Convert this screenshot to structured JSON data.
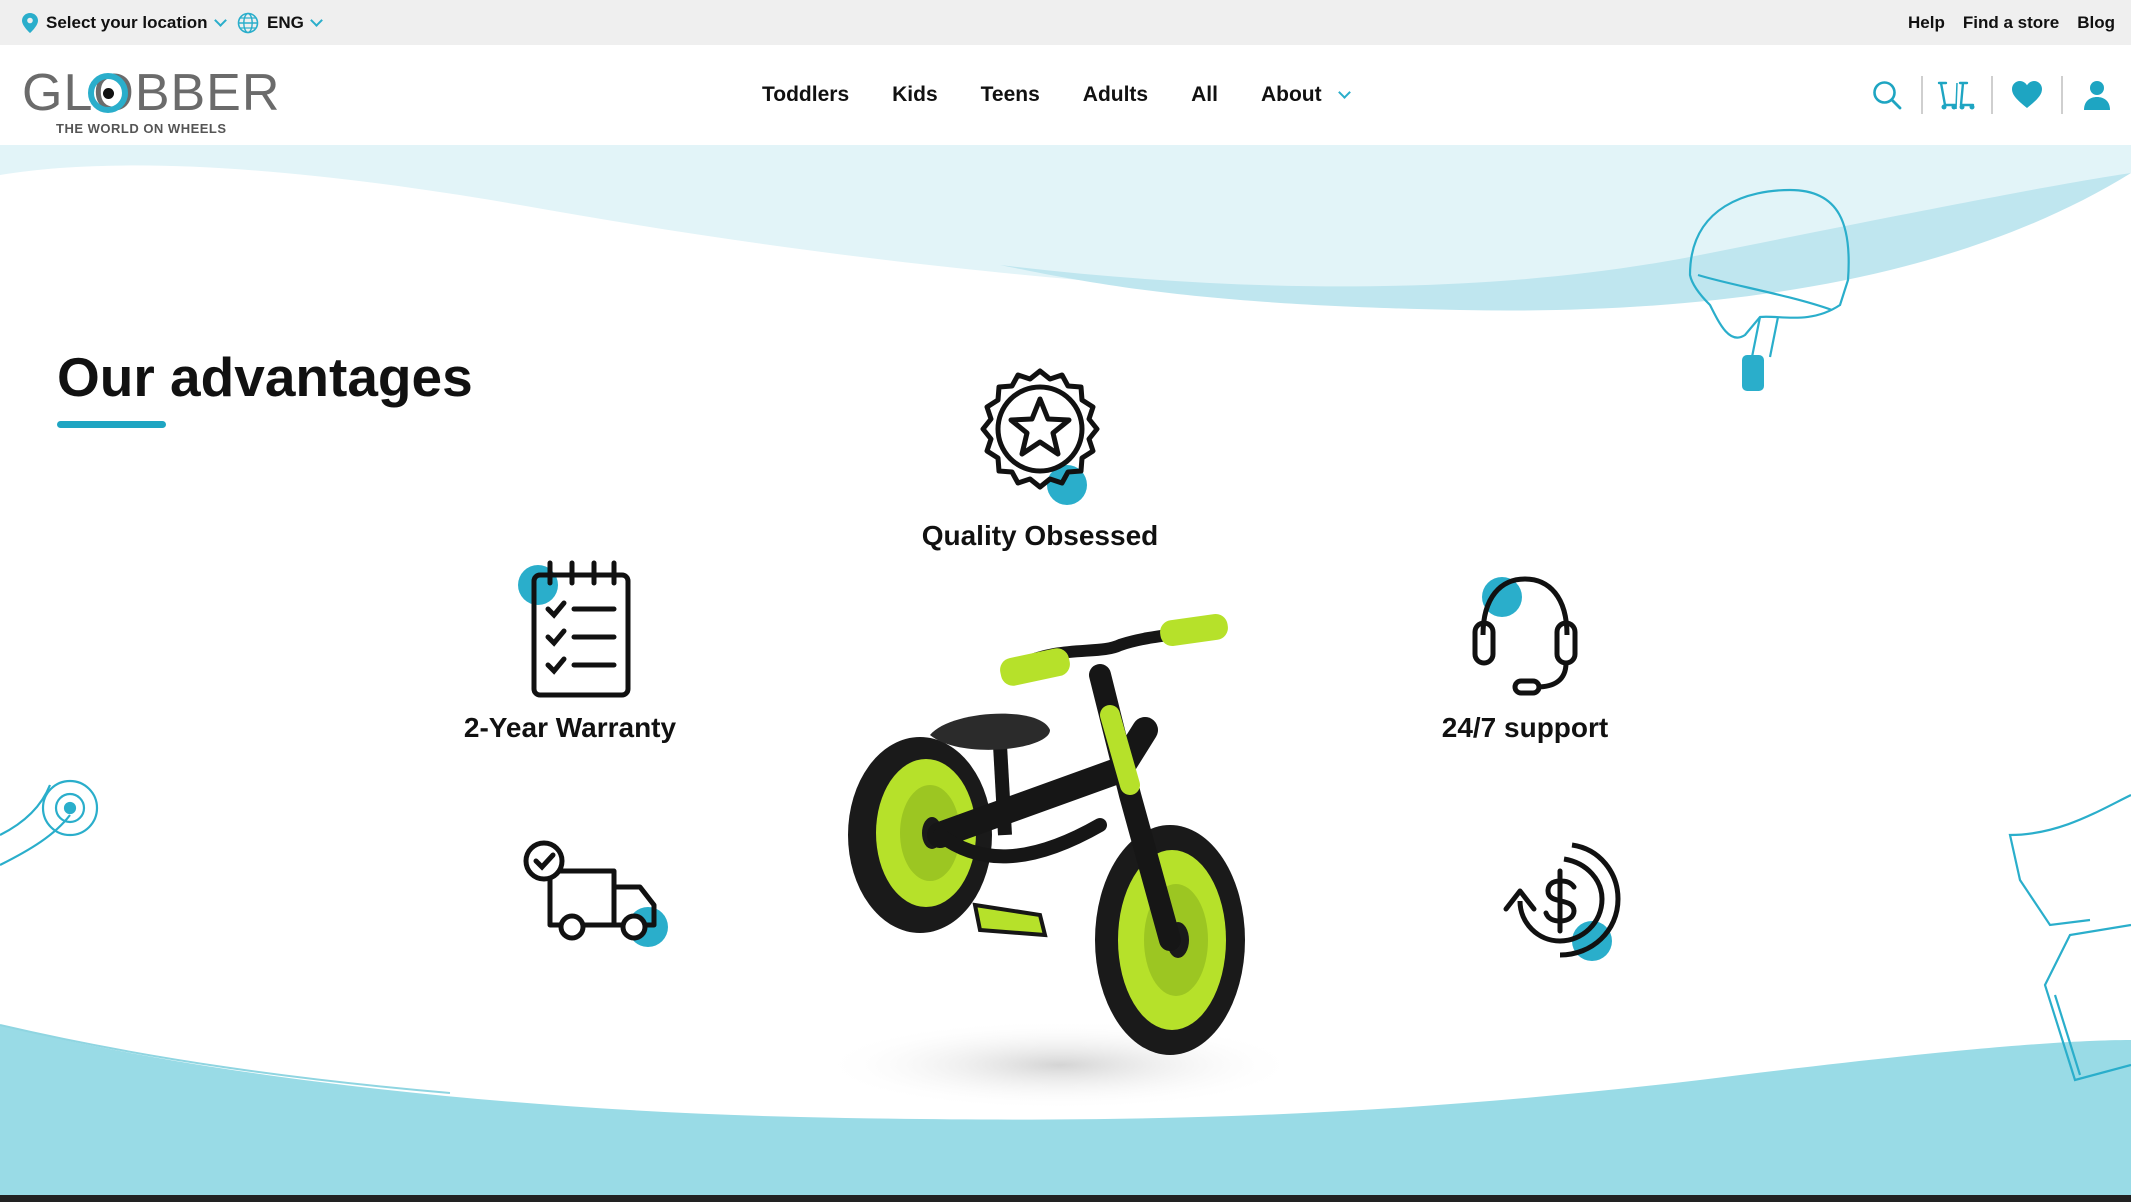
{
  "topbar": {
    "location_label": "Select your location",
    "language_label": "ENG",
    "links": [
      "Help",
      "Find a store",
      "Blog"
    ]
  },
  "header": {
    "logo_text": "GLOBBER",
    "logo_tagline": "THE WORLD ON WHEELS",
    "nav": [
      "Toddlers",
      "Kids",
      "Teens",
      "Adults",
      "All",
      "About"
    ],
    "icons": [
      "search-icon",
      "scooter-compare-icon",
      "heart-icon",
      "user-icon"
    ]
  },
  "main": {
    "title": "Our advantages",
    "advantages": [
      {
        "label": "Quality Obsessed",
        "icon": "badge-star-icon"
      },
      {
        "label": "2-Year Warranty",
        "icon": "checklist-icon"
      },
      {
        "label": "24/7 support",
        "icon": "headset-icon"
      },
      {
        "label": "",
        "icon": "delivery-truck-icon"
      },
      {
        "label": "",
        "icon": "money-back-icon"
      }
    ],
    "product_image": "balance-bike-lime-black"
  },
  "colors": {
    "accent": "#2aaecb",
    "wave_light": "#e2f4f8",
    "wave_mid": "#bfe6ef",
    "wave_bottom": "#99dbe6",
    "lime": "#b6e12a",
    "topbar_bg": "#efefef"
  }
}
